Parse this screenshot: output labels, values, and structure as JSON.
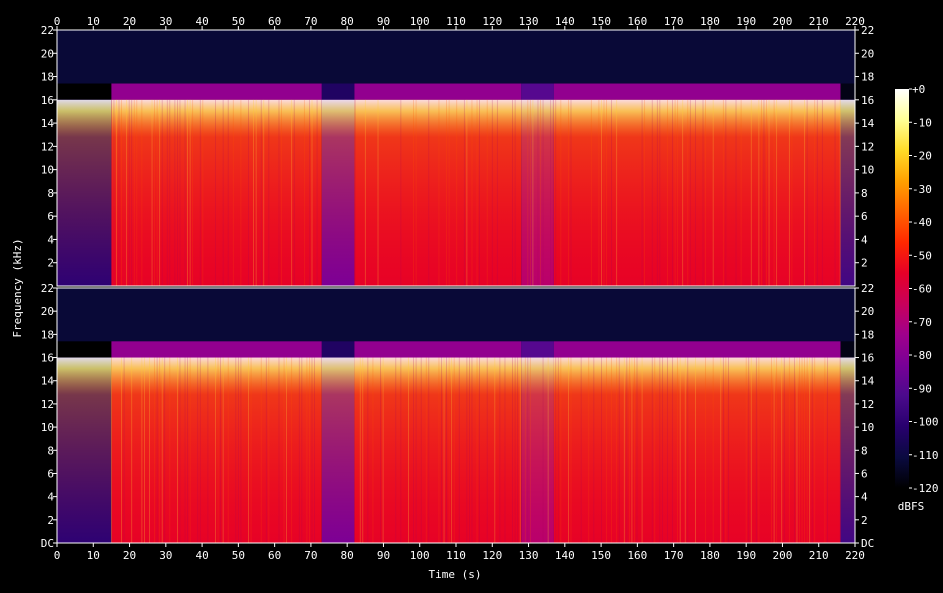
{
  "chart_data": {
    "type": "heatmap",
    "xlabel": "Time (s)",
    "ylabel": "Frequency (kHz)",
    "x_ticks": [
      "0",
      "10",
      "20",
      "30",
      "40",
      "50",
      "60",
      "70",
      "80",
      "90",
      "100",
      "110",
      "120",
      "130",
      "140",
      "150",
      "160",
      "170",
      "180",
      "190",
      "200",
      "210",
      "220"
    ],
    "xlim": [
      0,
      220
    ],
    "channels": [
      {
        "y_ticks": [
          "22",
          "20",
          "18",
          "16",
          "14",
          "12",
          "10",
          "8",
          "6",
          "4",
          "2"
        ],
        "ylim": [
          0,
          22
        ]
      },
      {
        "y_ticks": [
          "DC",
          "2",
          "4",
          "6",
          "8",
          "10",
          "12",
          "14",
          "16",
          "18",
          "20",
          "22"
        ],
        "ylim": [
          0,
          22
        ]
      }
    ],
    "colorbar": {
      "label": "dBFS",
      "range": [
        -120,
        0
      ],
      "ticks": [
        "+0",
        "-10",
        "-20",
        "-30",
        "-40",
        "-50",
        "-60",
        "-70",
        "-80",
        "-90",
        "-100",
        "-110",
        "-120"
      ],
      "colors": [
        "#000000",
        "#0a0a40",
        "#28006e",
        "#4b0a8c",
        "#780096",
        "#a0008c",
        "#c8005a",
        "#e60028",
        "#ff2800",
        "#ff6400",
        "#ffa000",
        "#ffdc28",
        "#ffff96",
        "#ffffff"
      ]
    },
    "segments": [
      {
        "t": [
          0,
          15
        ],
        "level_db": -100,
        "cutoff_khz": 16
      },
      {
        "t": [
          15,
          73
        ],
        "level_db": -55,
        "cutoff_khz": 16
      },
      {
        "t": [
          73,
          82
        ],
        "level_db": -82,
        "cutoff_khz": 16
      },
      {
        "t": [
          82,
          128
        ],
        "level_db": -55,
        "cutoff_khz": 16
      },
      {
        "t": [
          128,
          137
        ],
        "level_db": -68,
        "cutoff_khz": 16
      },
      {
        "t": [
          137,
          216
        ],
        "level_db": -55,
        "cutoff_khz": 16
      },
      {
        "t": [
          216,
          220
        ],
        "level_db": -95,
        "cutoff_khz": 16
      }
    ]
  }
}
